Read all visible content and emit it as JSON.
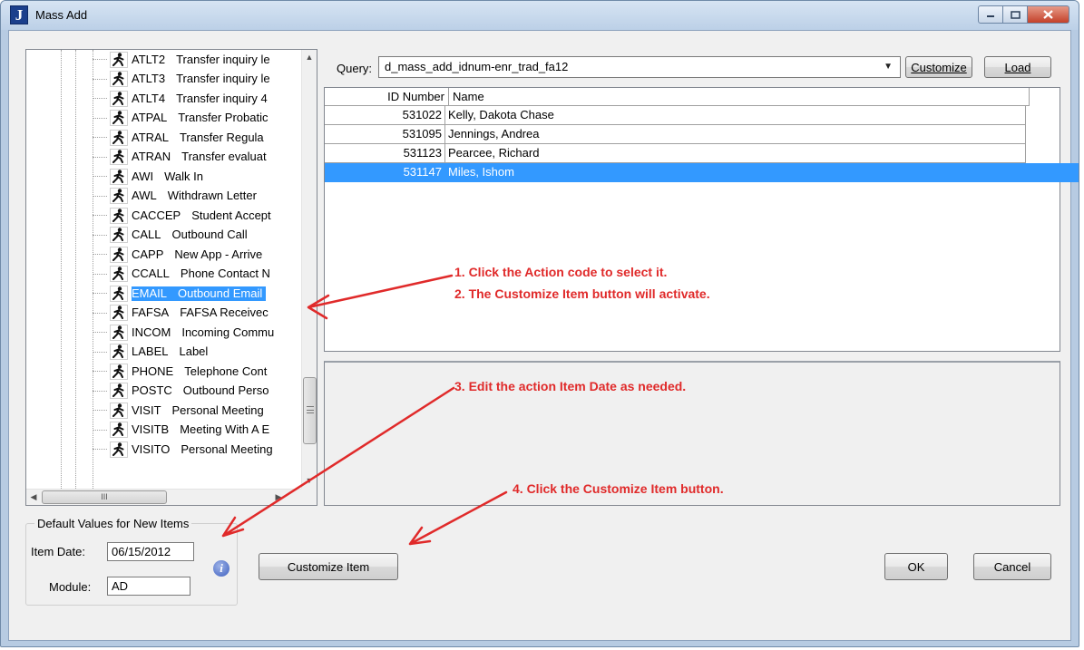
{
  "window": {
    "title": "Mass Add",
    "app_icon": "J",
    "controls": {
      "minimize": "minimize-icon",
      "maximize": "maximize-icon",
      "close": "close-icon"
    }
  },
  "tree": {
    "items": [
      {
        "code": "ATLT2",
        "desc": "Transfer inquiry le"
      },
      {
        "code": "ATLT3",
        "desc": "Transfer inquiry le"
      },
      {
        "code": "ATLT4",
        "desc": "Transfer inquiry 4"
      },
      {
        "code": "ATPAL",
        "desc": "Transfer Probatic"
      },
      {
        "code": "ATRAL",
        "desc": "Transfer Regula"
      },
      {
        "code": "ATRAN",
        "desc": "Transfer evaluat"
      },
      {
        "code": "AWI",
        "desc": "Walk In"
      },
      {
        "code": "AWL",
        "desc": "Withdrawn Letter"
      },
      {
        "code": "CACCEP",
        "desc": "Student Accept"
      },
      {
        "code": "CALL",
        "desc": "Outbound Call"
      },
      {
        "code": "CAPP",
        "desc": "New App - Arrive"
      },
      {
        "code": "CCALL",
        "desc": "Phone Contact N"
      },
      {
        "code": "EMAIL",
        "desc": "Outbound Email",
        "selected": true
      },
      {
        "code": "FAFSA",
        "desc": "FAFSA Receivec"
      },
      {
        "code": "INCOM",
        "desc": "Incoming Commu"
      },
      {
        "code": "LABEL",
        "desc": "Label"
      },
      {
        "code": "PHONE",
        "desc": "Telephone Cont"
      },
      {
        "code": "POSTC",
        "desc": "Outbound Perso"
      },
      {
        "code": "VISIT",
        "desc": "Personal Meeting"
      },
      {
        "code": "VISITB",
        "desc": "Meeting With A E"
      },
      {
        "code": "VISITO",
        "desc": "Personal Meeting"
      }
    ],
    "item_icon": "running-person-icon",
    "hscroll_grip": "III"
  },
  "defaults": {
    "legend": "Default Values for New Items",
    "item_date_label": "Item Date:",
    "item_date_value": "06/15/2012",
    "module_label": "Module:",
    "module_value": "AD",
    "info_icon": "i"
  },
  "query": {
    "label": "Query:",
    "value": "d_mass_add_idnum-enr_trad_fa12",
    "customize_label": "Customize",
    "load_label": "Load"
  },
  "grid": {
    "headers": {
      "id": "ID Number",
      "name": "Name"
    },
    "rows": [
      {
        "id": "531022",
        "name": "Kelly, Dakota Chase"
      },
      {
        "id": "531095",
        "name": "Jennings, Andrea"
      },
      {
        "id": "531123",
        "name": "Pearcee, Richard"
      },
      {
        "id": "531147",
        "name": "Miles, Ishom",
        "selected": true
      }
    ]
  },
  "buttons": {
    "customize_item": "Customize Item",
    "ok": "OK",
    "cancel": "Cancel"
  },
  "annotations": {
    "note1": "1. Click the Action code to select it.",
    "note2": "2. The Customize Item button will activate.",
    "note3": "3. Edit the action Item Date as needed.",
    "note4": "4. Click the Customize Item button.",
    "color": "#e02a2a"
  },
  "colors": {
    "selection": "#3399ff",
    "title_bar": "#c6d7ec",
    "close_button": "#c4412a"
  }
}
